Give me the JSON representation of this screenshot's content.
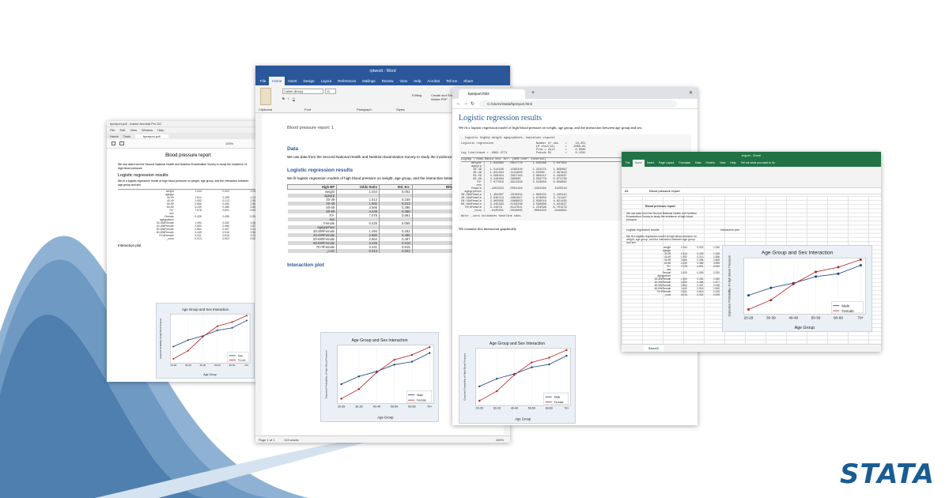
{
  "brand": {
    "logo_text": "STATA",
    "color": "#1a5c92"
  },
  "acrobat": {
    "title": "bpreport.pdf - Adobe Acrobat Pro DC",
    "menu": [
      "File",
      "Edit",
      "View",
      "Window",
      "Help"
    ],
    "tabs": [
      "Home",
      "Tools",
      "bpreport.pdf"
    ],
    "zoom": "100%",
    "doc_title": "Blood pressure report",
    "intro": "We use data from the Second National Health and Nutrition Examination Survey to study the incidence of high blood pressure.",
    "section": "Logistic regression results",
    "section_text": "We fit a logistic regression model of high blood pressure on weight, age group, and the interaction between age group and sex.",
    "plot_heading": "Interaction plot"
  },
  "word": {
    "title": "rptword - Word",
    "tabs": [
      "File",
      "Home",
      "Insert",
      "Design",
      "Layout",
      "References",
      "Mailings",
      "Review",
      "View",
      "Help",
      "Acrobat"
    ],
    "tell_me": "Tell me",
    "share": "Share",
    "font_name": "Calibri (Body)",
    "font_size": "11",
    "groups": [
      "Clipboard",
      "Font",
      "Paragraph",
      "Styles"
    ],
    "editing_label": "Editing",
    "create_pdf": "Create and Share Adobe PDF",
    "doc_header": "Blood pressure report: 1",
    "h_data": "Data",
    "p_data": "We use data from the Second National Health and Nutrition Examination Survey to study the incidence of high blood pressure.",
    "h_logit": "Logistic regression results",
    "p_logit": "We fit logistic regression models of high blood pressure on weight, age group, and the interaction between age group and sex.",
    "table_headers": [
      "High BP",
      "Odds Ratio",
      "Std. Err.",
      "95% Conf. Interval"
    ],
    "table_rows": [
      [
        "weight",
        "1.044",
        "0.002",
        "1.040"
      ],
      [
        "agegrp",
        "",
        "",
        ""
      ],
      [
        "30-39",
        "1.514",
        "0.159",
        "1.238"
      ],
      [
        "40-49",
        "1.932",
        "0.213",
        "1.556"
      ],
      [
        "50-59",
        "3.566",
        "0.396",
        "2.869"
      ],
      [
        "60-69",
        "4.249",
        "0.386",
        "3.555"
      ],
      [
        "70+",
        "7.078",
        "0.891",
        "5.530"
      ],
      [
        "sex",
        "",
        "",
        ""
      ],
      [
        "Female",
        "0.425",
        "0.055",
        "0.330"
      ],
      [
        "agegrp#sex",
        "",
        "",
        ""
      ],
      [
        "30-39#Female",
        "1.494",
        "0.262",
        "1.060"
      ],
      [
        "40-49#Female",
        "2.650",
        "0.466",
        "1.877"
      ],
      [
        "50-59#Female",
        "2.864",
        "0.497",
        "2.038"
      ],
      [
        "60-69#Female",
        "3.449",
        "0.518",
        "2.569"
      ],
      [
        "70+#Female",
        "3.241",
        "0.815",
        "2.235"
      ],
      [
        "_cons",
        "0.013",
        "0.002",
        "0.009"
      ]
    ],
    "h_plot": "Interaction plot",
    "status_page": "Page 1 of 1",
    "status_words": "124 words",
    "zoom": "100%"
  },
  "browser": {
    "tab_title": "bpreport.html",
    "address": "C:/Users/Stata/bpreport.html",
    "heading": "Logistic regression results",
    "intro": "We fit a logistic regression model of high blood pressure on weight, age group, and the interaction between age group and sex.",
    "command": ". logistic highbp weight agegrp##sex, nopvalues vsquish",
    "out_header": [
      "Logistic regression                         Number of obs    =     10,351",
      "                                            LR chi2(12)      =    2069.84",
      "                                            Prob > chi2      =     0.0000",
      "Log likelihood = -5862.3774                 Pseudo R2        =     0.1501"
    ],
    "out_cols": "      highbp | Odds Ratio   Std. Err.     [95% Conf. Interval]",
    "out_rows": [
      "      weight |   1.043864   .0017778      1.040386    1.047354",
      "      agegrp |",
      "       30-39 |   1.514166   .1585328      1.233275    1.859062",
      "       40-49 |   1.931904   .2131803      1.55586     2.397843",
      "       50-59 |   3.566454   .3957162      2.869412    4.432837",
      "       60-69 |   4.248484   .385805       3.556778    5.074739",
      "         70+ |   7.077616   .8911296      5.529658    9.058882",
      "         sex |",
      "      Female |   .4252623   .0554184      .3333292    .5425516",
      "  agegrp#sex |",
      "30-39#Female |   1.494007   .2615034      1.060155    2.105444",
      "40-49#Female |   2.649714   .4661847      1.876659    3.741167",
      "50-59#Female |   2.863095   .4966853      2.038516    4.021195",
      "60-69#Female |   3.449393   .5183338      2.568906    4.631627",
      "  70+#Female |   3.24079    .8147621      1.234598    8.701579",
      "       _cons |   .0125551   .0019005      .0093233    .0169062"
    ],
    "out_note": "Note: _cons estimates baseline odds.",
    "text2": "We examine this interaction graphically."
  },
  "excel": {
    "title": "export - Excel",
    "tabs": [
      "File",
      "Home",
      "Insert",
      "Page Layout",
      "Formulas",
      "Data",
      "Review",
      "View",
      "Help"
    ],
    "tell_me": "Tell me what you want to do",
    "cell_ref": "A1",
    "formula": "Blood pressure report",
    "sheet_name": "Sheet1",
    "b1": "Blood pressure report",
    "intro": "We use data from the Second National Health and Nutrition Examination Survey to study the incidence of high blood pressure.",
    "sec1": "Logistic regression results",
    "sec2": "Interaction plot",
    "sec1_text": "We fit a logistic regression model of high blood pressure on weight, age group, and the interaction between age group and sex."
  },
  "plot": {
    "title": "Age Group and Sex Interaction",
    "ylabel": "Expected Probability of High Blood Pressure",
    "xlabel": "Age Group",
    "legend": [
      "Male",
      "Female"
    ]
  },
  "chart_data": {
    "type": "line",
    "title": "Age Group and Sex Interaction",
    "xlabel": "Age Group",
    "ylabel": "Expected Probability of High Blood Pressure",
    "categories": [
      "20-29",
      "30-39",
      "40-49",
      "50-59",
      "60-69",
      "70+"
    ],
    "series": [
      {
        "name": "Male",
        "values": [
          0.4,
          0.48,
          0.53,
          0.6,
          0.63,
          0.72
        ],
        "color": "#1a3f7a"
      },
      {
        "name": "Female",
        "values": [
          0.25,
          0.35,
          0.52,
          0.65,
          0.7,
          0.78
        ],
        "color": "#b22222"
      }
    ],
    "ylim": [
      0.2,
      0.8
    ],
    "legend_position": "bottom-right",
    "grid": true
  }
}
